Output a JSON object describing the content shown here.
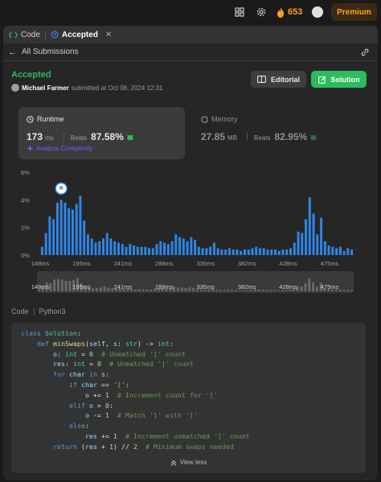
{
  "topbar": {
    "streak_count": "653",
    "premium_label": "Premium",
    "icons": [
      "grid-icon",
      "gear-icon",
      "fire-icon",
      "avatar"
    ]
  },
  "tabs": [
    {
      "label": "Code",
      "icon": "code-icon"
    },
    {
      "label": "Accepted",
      "icon": "history-icon",
      "active": true
    }
  ],
  "nav": {
    "back_label": "All Submissions"
  },
  "submission": {
    "status": "Accepted",
    "user": "Michael Farmer",
    "submitted_text": "submitted at Oct 08, 2024 12:31"
  },
  "buttons": {
    "editorial": "Editorial",
    "solution": "Solution"
  },
  "runtime": {
    "label": "Runtime",
    "value": "173",
    "unit": "ms",
    "beats_label": "Beats",
    "beats_pct": "87.58%",
    "analyze_label": "Analyze Complexity"
  },
  "memory": {
    "label": "Memory",
    "value": "27.85",
    "unit": "MB",
    "beats_label": "Beats",
    "beats_pct": "82.95%"
  },
  "chart_data": {
    "type": "bar",
    "y_ticks": [
      "6%",
      "4%",
      "2%",
      "0%"
    ],
    "ylim": [
      0,
      6
    ],
    "x_ticks": [
      "148ms",
      "195ms",
      "241ms",
      "288ms",
      "335ms",
      "382ms",
      "428ms",
      "475ms"
    ],
    "values": [
      0.6,
      1.6,
      2.8,
      2.6,
      3.8,
      4.0,
      3.8,
      3.4,
      3.3,
      3.7,
      4.3,
      2.5,
      1.5,
      1.2,
      0.9,
      1.0,
      1.2,
      1.6,
      1.2,
      1.0,
      0.9,
      0.8,
      0.6,
      0.8,
      0.7,
      0.6,
      0.6,
      0.6,
      0.5,
      0.5,
      0.8,
      1.0,
      0.9,
      0.8,
      1.0,
      1.5,
      1.3,
      1.2,
      1.0,
      1.3,
      1.1,
      0.6,
      0.5,
      0.5,
      0.6,
      0.9,
      0.5,
      0.4,
      0.4,
      0.5,
      0.4,
      0.4,
      0.3,
      0.4,
      0.4,
      0.5,
      0.6,
      0.5,
      0.5,
      0.4,
      0.4,
      0.4,
      0.3,
      0.4,
      0.4,
      0.5,
      0.9,
      1.7,
      1.6,
      2.6,
      4.2,
      3.0,
      1.5,
      2.7,
      1.0,
      0.7,
      0.6,
      0.5,
      0.6,
      0.3,
      0.5,
      0.4
    ],
    "highlight_index": 13,
    "bar_color": "#2f86e8",
    "highlight_color": "#1f5fb0"
  },
  "code": {
    "label": "Code",
    "language": "Python3",
    "view_less": "View less"
  },
  "colors": {
    "accent_green": "#2cbb5d",
    "brand_orange": "#ffa116",
    "analyze_purple": "#7a5af8"
  }
}
